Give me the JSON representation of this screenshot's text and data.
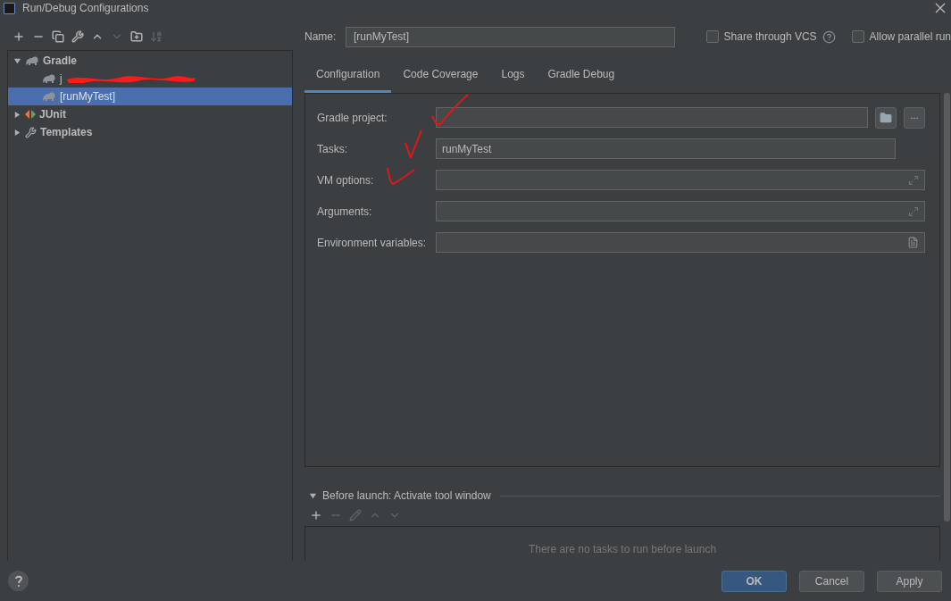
{
  "window": {
    "title": "Run/Debug Configurations"
  },
  "tree": [
    {
      "label": "Gradle",
      "kind": "gradle",
      "expanded": true,
      "selected": false,
      "children": [
        {
          "label": "j",
          "kind": "gradle-task",
          "redacted": true,
          "selected": false
        },
        {
          "label": "[runMyTest]",
          "kind": "gradle-task",
          "redacted": false,
          "selected": true
        }
      ]
    },
    {
      "label": "JUnit",
      "kind": "junit",
      "expanded": false,
      "selected": false
    },
    {
      "label": "Templates",
      "kind": "templates",
      "expanded": false,
      "selected": false
    }
  ],
  "name_field": {
    "label": "Name:",
    "value": "[runMyTest]"
  },
  "options": [
    {
      "label": "Share through VCS",
      "checked": false,
      "help": true
    },
    {
      "label": "Allow parallel run",
      "checked": false,
      "help": false
    }
  ],
  "tabs": [
    {
      "label": "Configuration",
      "selected": true
    },
    {
      "label": "Code Coverage",
      "selected": false
    },
    {
      "label": "Logs",
      "selected": false
    },
    {
      "label": "Gradle Debug",
      "selected": false
    }
  ],
  "fields": [
    {
      "label": "Gradle project:",
      "kind": "browse",
      "button": "..."
    },
    {
      "label": "Tasks:",
      "kind": "text",
      "value": "runMyTest"
    },
    {
      "label": "VM options:",
      "kind": "expand"
    },
    {
      "label": "Arguments:",
      "kind": "expand"
    },
    {
      "label": "Environment variables:",
      "kind": "env"
    }
  ],
  "before_launch": {
    "title": "Before launch: Activate tool window",
    "expanded": true,
    "empty_text": "There are no tasks to run before launch"
  },
  "buttons": [
    {
      "label": "OK",
      "kind": "primary"
    },
    {
      "label": "Cancel",
      "kind": "normal"
    },
    {
      "label": "Apply",
      "kind": "normal"
    }
  ]
}
